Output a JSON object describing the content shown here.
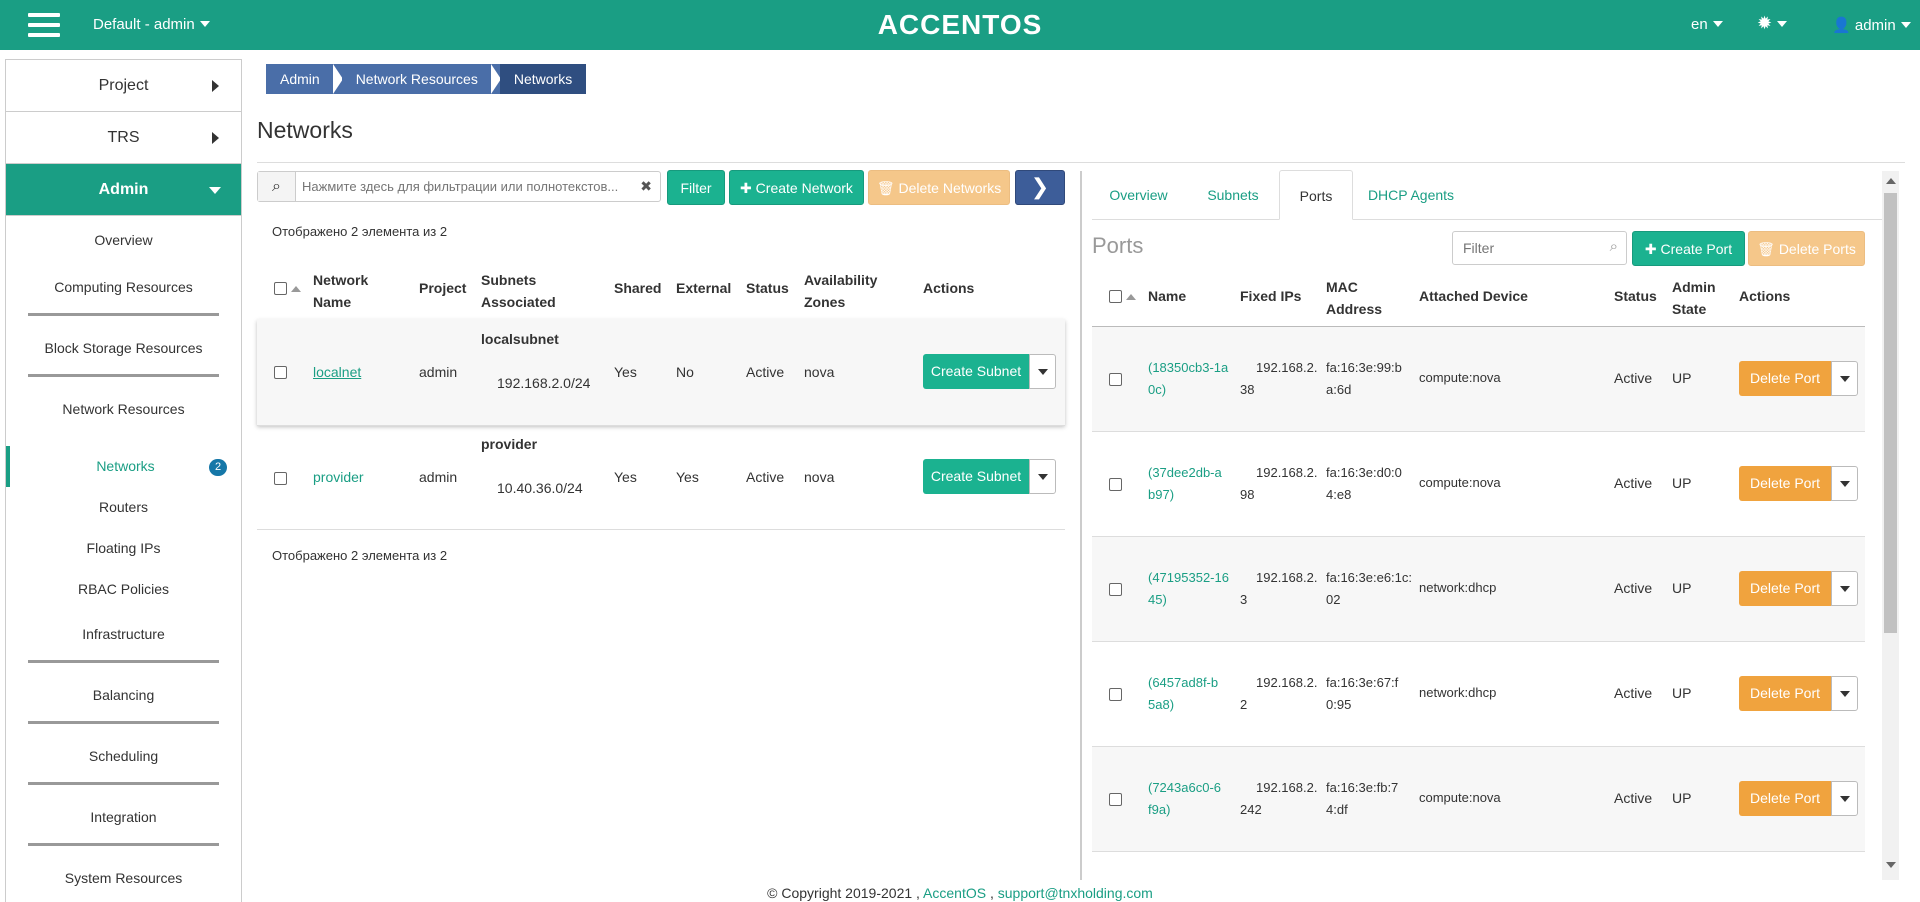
{
  "topbar": {
    "context": "Default - admin",
    "logo": "ACCENTOS",
    "lang": "en",
    "user": "admin",
    "accent": "#1a9e84"
  },
  "sidebar": {
    "project": "Project",
    "trs": "TRS",
    "admin": "Admin",
    "items": [
      "Overview",
      "Computing Resources",
      "Block Storage Resources",
      "Network Resources"
    ],
    "network_sub": [
      "Networks",
      "Routers",
      "Floating IPs",
      "RBAC Policies"
    ],
    "networks_badge": "2",
    "bottom": [
      "Infrastructure",
      "Balancing",
      "Scheduling",
      "Integration",
      "System Resources"
    ]
  },
  "breadcrumb": [
    "Admin",
    "Network Resources",
    "Networks"
  ],
  "page_title": "Networks",
  "toolbar": {
    "search_placeholder": "Нажмите здесь для фильтрации или полнотекстов...",
    "filter": "Filter",
    "create_network": "Create Network",
    "delete_networks": "Delete Networks"
  },
  "networks": {
    "count_text": "Отображено 2 элемента из 2",
    "headers": {
      "name": [
        "Network",
        "Name"
      ],
      "project": "Project",
      "subnets": [
        "Subnets",
        "Associated"
      ],
      "shared": "Shared",
      "external": "External",
      "status": "Status",
      "az": [
        "Availability",
        "Zones"
      ],
      "actions": "Actions"
    },
    "rows": [
      {
        "name": "localnet",
        "project": "admin",
        "subnet_name": "localsubnet",
        "subnet_cidr": "192.168.2.0/24",
        "shared": "Yes",
        "external": "No",
        "status": "Active",
        "az": "nova",
        "action": "Create Subnet"
      },
      {
        "name": "provider",
        "project": "admin",
        "subnet_name": "provider",
        "subnet_cidr": "10.40.36.0/24",
        "shared": "Yes",
        "external": "Yes",
        "status": "Active",
        "az": "nova",
        "action": "Create Subnet"
      }
    ]
  },
  "detail": {
    "tabs": [
      "Overview",
      "Subnets",
      "Ports",
      "DHCP Agents"
    ],
    "ports_title": "Ports",
    "filter_placeholder": "Filter",
    "create_port": "Create Port",
    "delete_ports": "Delete Ports",
    "headers": {
      "name": "Name",
      "fixed_ips": "Fixed IPs",
      "mac": [
        "MAC",
        "Address"
      ],
      "device": "Attached Device",
      "status": "Status",
      "admin_state": [
        "Admin",
        "State"
      ],
      "actions": "Actions"
    },
    "ports": [
      {
        "name": [
          "(18350cb3-1a",
          "0c)"
        ],
        "ip": [
          "192.168.2.",
          "38"
        ],
        "mac": [
          "fa:16:3e:99:b",
          "a:6d"
        ],
        "device": "compute:nova",
        "status": "Active",
        "state": "UP",
        "action": "Delete Port"
      },
      {
        "name": [
          "(37dee2db-a",
          "b97)"
        ],
        "ip": [
          "192.168.2.",
          "98"
        ],
        "mac": [
          "fa:16:3e:d0:0",
          "4:e8"
        ],
        "device": "compute:nova",
        "status": "Active",
        "state": "UP",
        "action": "Delete Port"
      },
      {
        "name": [
          "(47195352-16",
          "45)"
        ],
        "ip": [
          "192.168.2.",
          "3"
        ],
        "mac": [
          "fa:16:3e:e6:1c:",
          "02"
        ],
        "device": "network:dhcp",
        "status": "Active",
        "state": "UP",
        "action": "Delete Port"
      },
      {
        "name": [
          "(6457ad8f-b",
          "5a8)"
        ],
        "ip": [
          "192.168.2.",
          "2"
        ],
        "mac": [
          "fa:16:3e:67:f",
          "0:95"
        ],
        "device": "network:dhcp",
        "status": "Active",
        "state": "UP",
        "action": "Delete Port"
      },
      {
        "name": [
          "(7243a6c0-6",
          "f9a)"
        ],
        "ip": [
          "192.168.2.",
          "242"
        ],
        "mac": [
          "fa:16:3e:fb:7",
          "4:df"
        ],
        "device": "compute:nova",
        "status": "Active",
        "state": "UP",
        "action": "Delete Port"
      }
    ]
  },
  "footer": {
    "copyright": "© Copyright 2019-2021 ,",
    "brand": "AccentOS",
    "sep": ",",
    "email": "support@tnxholding.com"
  }
}
